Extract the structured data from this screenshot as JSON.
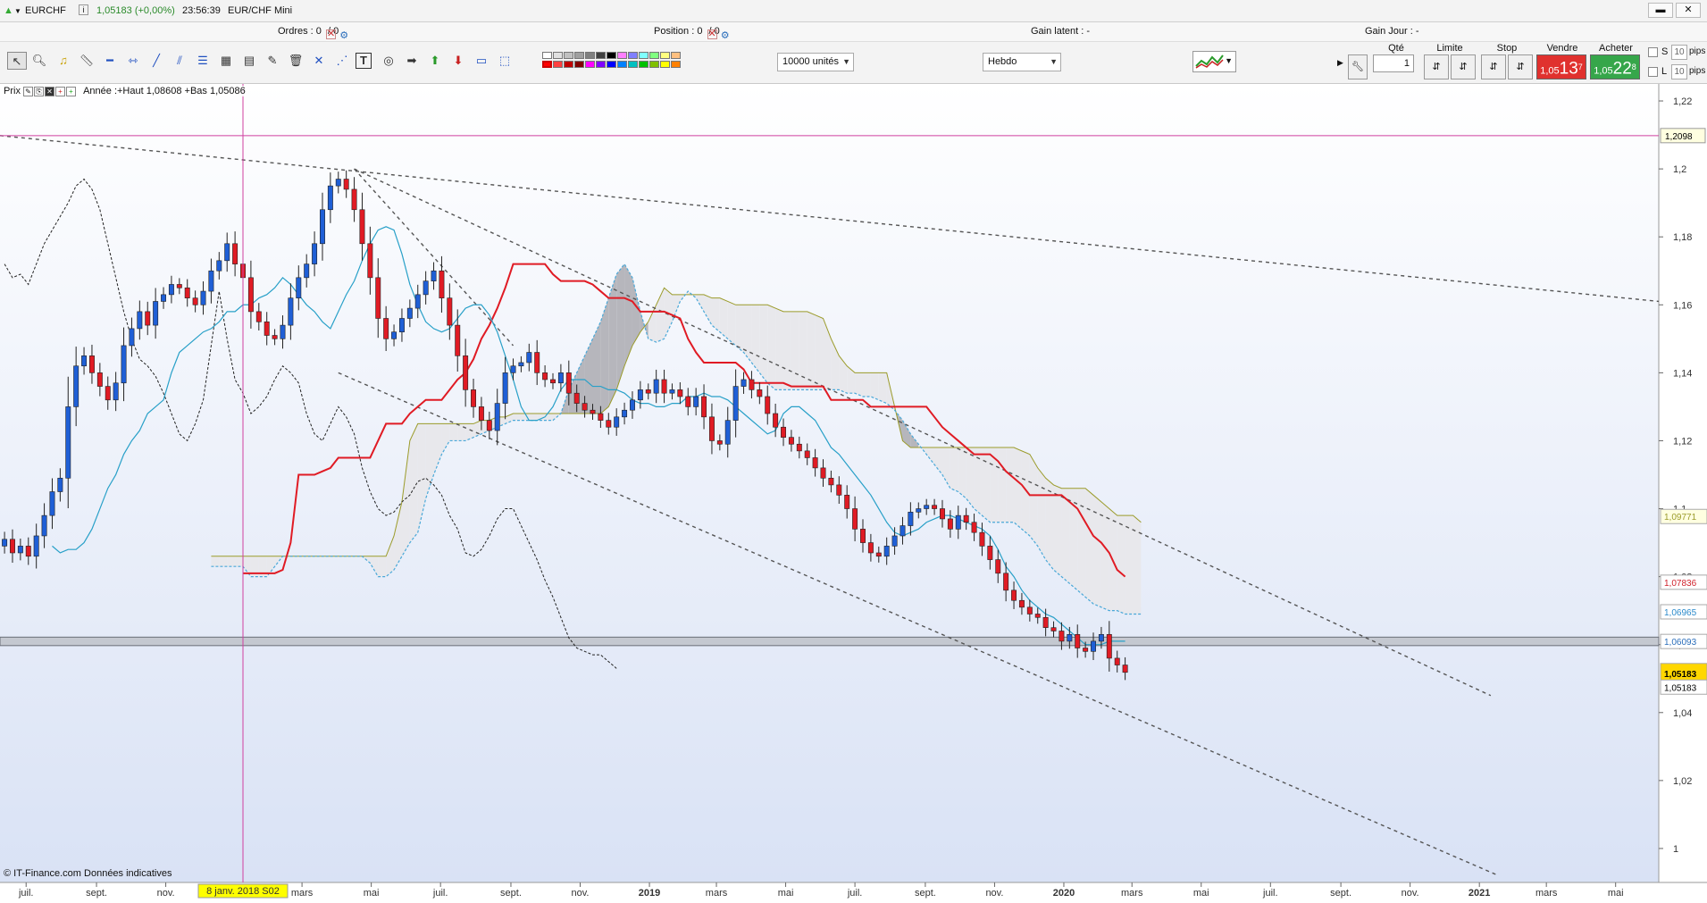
{
  "window": {
    "symbol": "EURCHF",
    "info_icon": "i",
    "quote": "1,05183 (+0,00%)",
    "time": "23:56:39",
    "name": "EUR/CHF Mini"
  },
  "infobar": {
    "ordres_label": "Ordres :",
    "ordres_value": "0",
    "ordres_sep": "/ 0",
    "position_label": "Position :",
    "position_value": "0",
    "position_sep": "/ 0",
    "gain_latent": "Gain latent :  -",
    "gain_jour": "Gain Jour :  -"
  },
  "toolbar": {
    "units_select": "10000 unités",
    "period_select": "Hebdo",
    "icons": [
      "cursor-icon",
      "zoom-icon",
      "alert-bell-icon",
      "ruler-icon",
      "horizontal-line-icon",
      "horizontal-segment-icon",
      "trendline-icon",
      "parallel-channel-icon",
      "fibonacci-icon",
      "grid-icon",
      "retracement-icon",
      "erase-icon",
      "trash-icon",
      "cross-icon",
      "regression-icon",
      "text-icon",
      "target-icon",
      "arrow-right-icon",
      "arrow-up-icon",
      "arrow-down-icon",
      "rectangle-icon",
      "rectangle-select-icon"
    ]
  },
  "order_panel": {
    "qty_label": "Qté",
    "qty_value": "1",
    "limit_label": "Limite",
    "stop_label": "Stop",
    "sell_label": "Vendre",
    "buy_label": "Acheter",
    "sell_small": "1,05",
    "sell_big": "13",
    "sell_sup": "7",
    "buy_small": "1,05",
    "buy_big": "22",
    "buy_sup": "8",
    "s_label": "S",
    "l_label": "L",
    "s_pips": "10",
    "l_pips": "10",
    "pips_label": "pips",
    "colors": {
      "sell": "#e0312e",
      "buy": "#36a64a"
    }
  },
  "legend": {
    "prix": "Prix",
    "annee": "Année :+Haut 1,08608 +Bas 1,05086"
  },
  "copyright": "© IT-Finance.com Données indicatives",
  "chart_data": {
    "type": "candlestick",
    "timeframe": "Hebdo",
    "ylim": [
      0.99,
      1.225
    ],
    "y_ticks": [
      1.22,
      1.2,
      1.18,
      1.16,
      1.14,
      1.12,
      1.1,
      1.08,
      1.06,
      1.04,
      1.02,
      1.0
    ],
    "y_tick_labels": [
      "1,22",
      "1,2",
      "1,18",
      "1,16",
      "1,14",
      "1,12",
      "1,1",
      "1,08",
      "1,06",
      "1,04",
      "1,02",
      "1"
    ],
    "x_range": [
      "2017-06-08",
      "2021-06-08"
    ],
    "x_ticks": [
      {
        "date": "2017-07-01",
        "label": "juil."
      },
      {
        "date": "2017-09-01",
        "label": "sept."
      },
      {
        "date": "2017-11-01",
        "label": "nov."
      },
      {
        "date": "2018-03-01",
        "label": "mars"
      },
      {
        "date": "2018-05-01",
        "label": "mai"
      },
      {
        "date": "2018-07-01",
        "label": "juil."
      },
      {
        "date": "2018-09-01",
        "label": "sept."
      },
      {
        "date": "2018-11-01",
        "label": "nov."
      },
      {
        "date": "2019-01-01",
        "label": "2019",
        "year": true
      },
      {
        "date": "2019-03-01",
        "label": "mars"
      },
      {
        "date": "2019-05-01",
        "label": "mai"
      },
      {
        "date": "2019-07-01",
        "label": "juil."
      },
      {
        "date": "2019-09-01",
        "label": "sept."
      },
      {
        "date": "2019-11-01",
        "label": "nov."
      },
      {
        "date": "2020-01-01",
        "label": "2020",
        "year": true
      },
      {
        "date": "2020-03-01",
        "label": "mars"
      },
      {
        "date": "2020-05-01",
        "label": "mai"
      },
      {
        "date": "2020-07-01",
        "label": "juil."
      },
      {
        "date": "2020-09-01",
        "label": "sept."
      },
      {
        "date": "2020-11-01",
        "label": "nov."
      },
      {
        "date": "2021-01-01",
        "label": "2021",
        "year": true
      },
      {
        "date": "2021-03-01",
        "label": "mars"
      },
      {
        "date": "2021-05-01",
        "label": "mai"
      }
    ],
    "crosshair": {
      "date": "2018-01-08",
      "label": "8 janv. 2018 S02",
      "price": 1.2098,
      "price_label": "1,2098"
    },
    "price_labels": [
      {
        "value": 1.09771,
        "label": "1,09771",
        "color": "#9b9b2a",
        "bg": "#ffffe0"
      },
      {
        "value": 1.07836,
        "label": "1,07836",
        "color": "#d0202a",
        "bg": "#ffffff"
      },
      {
        "value": 1.06965,
        "label": "1,06965",
        "color": "#2a8acb",
        "bg": "#ffffff"
      },
      {
        "value": 1.06093,
        "label": "1,06093",
        "color": "#2a6ebb",
        "bg": "#ffffff"
      },
      {
        "value": 1.05183,
        "label": "1,05183",
        "color": "#000000",
        "bg": "#ffd700",
        "current": true
      },
      {
        "value": 1.0475,
        "label": "1,05183",
        "color": "#000000",
        "bg": "#ffffff"
      }
    ],
    "support_band": [
      1.0597,
      1.0622
    ],
    "candles_start": "2017-06-12",
    "closes": [
      1.091,
      1.087,
      1.089,
      1.086,
      1.092,
      1.098,
      1.105,
      1.109,
      1.13,
      1.142,
      1.145,
      1.14,
      1.136,
      1.132,
      1.137,
      1.148,
      1.153,
      1.158,
      1.154,
      1.161,
      1.163,
      1.166,
      1.165,
      1.162,
      1.16,
      1.164,
      1.17,
      1.173,
      1.178,
      1.172,
      1.168,
      1.158,
      1.155,
      1.151,
      1.15,
      1.154,
      1.162,
      1.168,
      1.172,
      1.178,
      1.188,
      1.195,
      1.197,
      1.194,
      1.188,
      1.178,
      1.168,
      1.156,
      1.15,
      1.152,
      1.156,
      1.159,
      1.163,
      1.167,
      1.17,
      1.162,
      1.154,
      1.145,
      1.135,
      1.13,
      1.126,
      1.123,
      1.131,
      1.14,
      1.142,
      1.143,
      1.146,
      1.14,
      1.138,
      1.137,
      1.14,
      1.134,
      1.131,
      1.129,
      1.128,
      1.126,
      1.124,
      1.127,
      1.129,
      1.132,
      1.135,
      1.134,
      1.138,
      1.134,
      1.135,
      1.133,
      1.13,
      1.133,
      1.127,
      1.12,
      1.119,
      1.126,
      1.136,
      1.138,
      1.135,
      1.133,
      1.128,
      1.124,
      1.121,
      1.119,
      1.117,
      1.115,
      1.112,
      1.109,
      1.107,
      1.104,
      1.1,
      1.094,
      1.09,
      1.087,
      1.086,
      1.089,
      1.092,
      1.095,
      1.099,
      1.1,
      1.101,
      1.1,
      1.097,
      1.094,
      1.098,
      1.096,
      1.093,
      1.089,
      1.085,
      1.081,
      1.076,
      1.073,
      1.071,
      1.069,
      1.068,
      1.065,
      1.064,
      1.061,
      1.063,
      1.059,
      1.058,
      1.061,
      1.063,
      1.056,
      1.054,
      1.05183
    ],
    "kijun": [
      1.081,
      1.081,
      1.081,
      1.081,
      1.081,
      1.082,
      1.09,
      1.11,
      1.11,
      1.11,
      1.111,
      1.112,
      1.115,
      1.115,
      1.115,
      1.115,
      1.115,
      1.12,
      1.125,
      1.125,
      1.125,
      1.128,
      1.13,
      1.132,
      1.132,
      1.132,
      1.135,
      1.138,
      1.14,
      1.144,
      1.15,
      1.154,
      1.159,
      1.165,
      1.172,
      1.172,
      1.172,
      1.172,
      1.172,
      1.169,
      1.167,
      1.167,
      1.167,
      1.167,
      1.166,
      1.164,
      1.162,
      1.162,
      1.162,
      1.161,
      1.158,
      1.158,
      1.158,
      1.158,
      1.157,
      1.156,
      1.15,
      1.146,
      1.143,
      1.143,
      1.143,
      1.143,
      1.143,
      1.141,
      1.137,
      1.137,
      1.137,
      1.137,
      1.137,
      1.136,
      1.136,
      1.136,
      1.136,
      1.136,
      1.132,
      1.132,
      1.132,
      1.132,
      1.132,
      1.13,
      1.13,
      1.13,
      1.13,
      1.13,
      1.13,
      1.13,
      1.13,
      1.127,
      1.124,
      1.122,
      1.12,
      1.118,
      1.116,
      1.116,
      1.116,
      1.114,
      1.111,
      1.109,
      1.107,
      1.104,
      1.104,
      1.104,
      1.104,
      1.104,
      1.102,
      1.1,
      1.096,
      1.092,
      1.09,
      1.087,
      1.082,
      1.08
    ],
    "tenkan": [
      1.089,
      1.087,
      1.088,
      1.088,
      1.09,
      1.094,
      1.1,
      1.106,
      1.11,
      1.116,
      1.12,
      1.123,
      1.128,
      1.13,
      1.132,
      1.14,
      1.146,
      1.148,
      1.15,
      1.152,
      1.153,
      1.155,
      1.158,
      1.158,
      1.16,
      1.16,
      1.162,
      1.163,
      1.165,
      1.168,
      1.166,
      1.163,
      1.16,
      1.158,
      1.155,
      1.153,
      1.158,
      1.163,
      1.167,
      1.173,
      1.178,
      1.182,
      1.183,
      1.182,
      1.175,
      1.166,
      1.16,
      1.155,
      1.153,
      1.152,
      1.153,
      1.156,
      1.159,
      1.16,
      1.16,
      1.157,
      1.152,
      1.145,
      1.138,
      1.13,
      1.126,
      1.126,
      1.127,
      1.13,
      1.135,
      1.138,
      1.138,
      1.138,
      1.136,
      1.136,
      1.135,
      1.135,
      1.134,
      1.132,
      1.131,
      1.131,
      1.13,
      1.13,
      1.131,
      1.131,
      1.133,
      1.133,
      1.134,
      1.133,
      1.133,
      1.132,
      1.13,
      1.128,
      1.126,
      1.124,
      1.122,
      1.123,
      1.128,
      1.13,
      1.13,
      1.128,
      1.126,
      1.122,
      1.118,
      1.116,
      1.113,
      1.11,
      1.107,
      1.104,
      1.1,
      1.096,
      1.093,
      1.092,
      1.093,
      1.094,
      1.096,
      1.097,
      1.098,
      1.098,
      1.097,
      1.096,
      1.095,
      1.094,
      1.092,
      1.088,
      1.083,
      1.08,
      1.076,
      1.073,
      1.071,
      1.069,
      1.068,
      1.066,
      1.064,
      1.062,
      1.06,
      1.06,
      1.06,
      1.061,
      1.061,
      1.061
    ],
    "chikou": [
      1.172,
      1.168,
      1.169,
      1.166,
      1.172,
      1.178,
      1.182,
      1.186,
      1.19,
      1.195,
      1.197,
      1.194,
      1.188,
      1.178,
      1.168,
      1.158,
      1.15,
      1.144,
      1.142,
      1.139,
      1.134,
      1.128,
      1.122,
      1.12,
      1.125,
      1.132,
      1.148,
      1.164,
      1.15,
      1.138,
      1.134,
      1.128,
      1.13,
      1.133,
      1.138,
      1.142,
      1.14,
      1.137,
      1.128,
      1.122,
      1.12,
      1.125,
      1.13,
      1.127,
      1.122,
      1.112,
      1.105,
      1.1,
      1.098,
      1.099,
      1.102,
      1.104,
      1.108,
      1.109,
      1.107,
      1.104,
      1.098,
      1.094,
      1.087,
      1.086,
      1.088,
      1.092,
      1.097,
      1.1,
      1.1,
      1.095,
      1.09,
      1.085,
      1.079,
      1.074,
      1.068,
      1.062,
      1.059,
      1.058,
      1.057,
      1.057,
      1.055,
      1.053
    ],
    "kumo_a": [
      1.086,
      1.086,
      1.086,
      1.086,
      1.086,
      1.086,
      1.086,
      1.086,
      1.086,
      1.086,
      1.086,
      1.086,
      1.086,
      1.086,
      1.086,
      1.086,
      1.086,
      1.086,
      1.086,
      1.086,
      1.086,
      1.086,
      1.086,
      1.092,
      1.102,
      1.12,
      1.125,
      1.125,
      1.125,
      1.125,
      1.125,
      1.125,
      1.125,
      1.125,
      1.126,
      1.126,
      1.127,
      1.127,
      1.128,
      1.128,
      1.128,
      1.128,
      1.128,
      1.128,
      1.128,
      1.128,
      1.128,
      1.128,
      1.128,
      1.128,
      1.13,
      1.135,
      1.142,
      1.148,
      1.152,
      1.155,
      1.16,
      1.165,
      1.163,
      1.163,
      1.163,
      1.163,
      1.163,
      1.162,
      1.162,
      1.161,
      1.16,
      1.16,
      1.16,
      1.16,
      1.16,
      1.159,
      1.158,
      1.158,
      1.158,
      1.158,
      1.157,
      1.156,
      1.15,
      1.145,
      1.142,
      1.14,
      1.14,
      1.14,
      1.14,
      1.14,
      1.13,
      1.12,
      1.118,
      1.118,
      1.118,
      1.118,
      1.118,
      1.118,
      1.118,
      1.118,
      1.118,
      1.118,
      1.118,
      1.118,
      1.118,
      1.118,
      1.117,
      1.116,
      1.112,
      1.109,
      1.107,
      1.106,
      1.106,
      1.106,
      1.106,
      1.104,
      1.102,
      1.1,
      1.098,
      1.098,
      1.098,
      1.096
    ],
    "kumo_b": [
      1.083,
      1.083,
      1.083,
      1.083,
      1.083,
      1.08,
      1.08,
      1.08,
      1.083,
      1.086,
      1.086,
      1.086,
      1.086,
      1.086,
      1.086,
      1.086,
      1.086,
      1.086,
      1.086,
      1.086,
      1.084,
      1.08,
      1.08,
      1.082,
      1.086,
      1.09,
      1.093,
      1.103,
      1.11,
      1.116,
      1.12,
      1.12,
      1.12,
      1.121,
      1.122,
      1.123,
      1.124,
      1.125,
      1.126,
      1.126,
      1.126,
      1.126,
      1.126,
      1.126,
      1.128,
      1.135,
      1.14,
      1.145,
      1.15,
      1.155,
      1.162,
      1.169,
      1.172,
      1.168,
      1.158,
      1.15,
      1.149,
      1.15,
      1.155,
      1.161,
      1.164,
      1.162,
      1.158,
      1.154,
      1.152,
      1.15,
      1.148,
      1.146,
      1.143,
      1.14,
      1.137,
      1.135,
      1.135,
      1.135,
      1.135,
      1.135,
      1.135,
      1.135,
      1.135,
      1.135,
      1.134,
      1.134,
      1.133,
      1.133,
      1.132,
      1.131,
      1.129,
      1.126,
      1.122,
      1.119,
      1.116,
      1.113,
      1.11,
      1.106,
      1.105,
      1.103,
      1.1,
      1.098,
      1.096,
      1.096,
      1.096,
      1.096,
      1.094,
      1.092,
      1.089,
      1.085,
      1.082,
      1.08,
      1.078,
      1.076,
      1.074,
      1.072,
      1.071,
      1.07,
      1.07,
      1.069,
      1.069,
      1.069
    ],
    "trendlines": [
      {
        "from": [
          "2017-06-08",
          1.2098
        ],
        "to": [
          "2021-06-08",
          1.161
        ]
      },
      {
        "from": [
          "2018-04-16",
          1.2
        ],
        "to": [
          "2021-01-11",
          1.045
        ]
      },
      {
        "from": [
          "2018-04-16",
          1.2
        ],
        "to": [
          "2018-09-03",
          1.148
        ]
      },
      {
        "from": [
          "2018-04-02",
          1.14
        ],
        "to": [
          "2021-01-18",
          0.992
        ]
      }
    ]
  }
}
